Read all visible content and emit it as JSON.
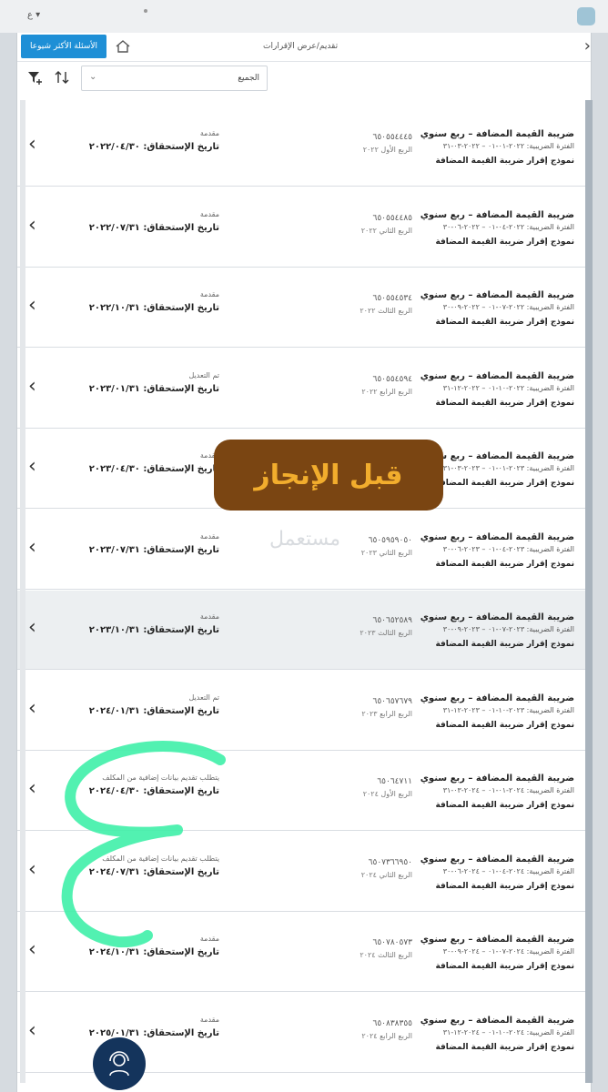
{
  "topbar": {
    "lang": "ع"
  },
  "header": {
    "faq_button": "الأسئلة الأكثر شيوعا",
    "breadcrumb": "تقديم/عرض الإقرارات"
  },
  "filter": {
    "selected": "الجميع"
  },
  "rows": [
    {
      "title": "ضريبة القيمة المضافة – ربع سنوي",
      "period": "الفترة الضريبية: ٢٠٢٢-٠١-٠١ – ٢٠٢٢-٠٣-٣١",
      "form": "نموذج إقرار ضريبة القيمة المضافة",
      "number": "٦٥٠٥٥٤٤٤٥",
      "quarter": "الربع الأول ٢٠٢٢",
      "status": "مقدمة",
      "due": "تاريخ الإستحقاق: ٢٠٢٢/٠٤/٣٠"
    },
    {
      "title": "ضريبة القيمة المضافة – ربع سنوي",
      "period": "الفترة الضريبية: ٢٠٢٢-٠٤-٠١ – ٢٠٢٢-٠٦-٣٠",
      "form": "نموذج إقرار ضريبة القيمة المضافة",
      "number": "٦٥٠٥٥٤٤٨٥",
      "quarter": "الربع الثاني ٢٠٢٢",
      "status": "مقدمة",
      "due": "تاريخ الإستحقاق: ٢٠٢٢/٠٧/٣١"
    },
    {
      "title": "ضريبة القيمة المضافة – ربع سنوي",
      "period": "الفترة الضريبية: ٢٠٢٢-٠٧-٠١ – ٢٠٢٢-٠٩-٣٠",
      "form": "نموذج إقرار ضريبة القيمة المضافة",
      "number": "٦٥٠٥٥٤٥٣٤",
      "quarter": "الربع الثالث ٢٠٢٢",
      "status": "مقدمة",
      "due": "تاريخ الإستحقاق: ٢٠٢٢/١٠/٣١"
    },
    {
      "title": "ضريبة القيمة المضافة – ربع سنوي",
      "period": "الفترة الضريبية: ٢٠٢٢-١٠-٠١ – ٢٠٢٢-١٢-٣١",
      "form": "نموذج إقرار ضريبة القيمة المضافة",
      "number": "٦٥٠٥٥٤٥٩٤",
      "quarter": "الربع الرابع ٢٠٢٢",
      "status": "تم التعديل",
      "due": "تاريخ الإستحقاق: ٢٠٢٣/٠١/٣١"
    },
    {
      "title": "ضريبة القيمة المضافة – ربع سنوي",
      "period": "الفترة الضريبية: ٢٠٢٣-٠١-٠١ – ٢٠٢٣-٠٣-٣١",
      "form": "نموذج إقرار ضريبة القيمة المضافة",
      "number": "",
      "quarter": "",
      "status": "مقدمة",
      "due": "تاريخ الإستحقاق: ٢٠٢٣/٠٤/٣٠"
    },
    {
      "title": "ضريبة القيمة المضافة – ربع سنوي",
      "period": "الفترة الضريبية: ٢٠٢٣-٠٤-٠١ – ٢٠٢٣-٠٦-٣٠",
      "form": "نموذج إقرار ضريبة القيمة المضافة",
      "number": "٦٥٠٥٩٥٩٠٥٠",
      "quarter": "الربع الثاني ٢٠٢٣",
      "status": "مقدمة",
      "due": "تاريخ الإستحقاق: ٢٠٢٣/٠٧/٣١"
    },
    {
      "title": "ضريبة القيمة المضافة – ربع سنوي",
      "period": "الفترة الضريبية: ٢٠٢٣-٠٧-٠١ – ٢٠٢٣-٠٩-٣٠",
      "form": "نموذج إقرار ضريبة القيمة المضافة",
      "number": "٦٥٠٦٥٢٥٨٩",
      "quarter": "الربع الثالث ٢٠٢٣",
      "status": "مقدمة",
      "due": "تاريخ الإستحقاق: ٢٠٢٣/١٠/٣١"
    },
    {
      "title": "ضريبة القيمة المضافة – ربع سنوي",
      "period": "الفترة الضريبية: ٢٠٢٣-١٠-٠١ – ٢٠٢٣-١٢-٣١",
      "form": "نموذج إقرار ضريبة القيمة المضافة",
      "number": "٦٥٠٦٥٧٦٧٩",
      "quarter": "الربع الرابع ٢٠٢٣",
      "status": "تم التعديل",
      "due": "تاريخ الإستحقاق: ٢٠٢٤/٠١/٣١"
    },
    {
      "title": "ضريبة القيمة المضافة – ربع سنوي",
      "period": "الفترة الضريبية: ٢٠٢٤-٠١-٠١ – ٢٠٢٤-٠٣-٣١",
      "form": "نموذج إقرار ضريبة القيمة المضافة",
      "number": "٦٥٠٦٤٧١١",
      "quarter": "الربع الأول ٢٠٢٤",
      "status": "يتطلب تقديم بيانات إضافية من المكلف",
      "due": "تاريخ الإستحقاق: ٢٠٢٤/٠٤/٣٠"
    },
    {
      "title": "ضريبة القيمة المضافة – ربع سنوي",
      "period": "الفترة الضريبية: ٢٠٢٤-٠٤-٠١ – ٢٠٢٤-٠٦-٣٠",
      "form": "نموذج إقرار ضريبة القيمة المضافة",
      "number": "٦٥٠٧٣٦٦٩٥٠",
      "quarter": "الربع الثاني ٢٠٢٤",
      "status": "يتطلب تقديم بيانات إضافية من المكلف",
      "due": "تاريخ الإستحقاق: ٢٠٢٤/٠٧/٣١"
    },
    {
      "title": "ضريبة القيمة المضافة – ربع سنوي",
      "period": "الفترة الضريبية: ٢٠٢٤-٠٧-٠١ – ٢٠٢٤-٠٩-٣٠",
      "form": "نموذج إقرار ضريبة القيمة المضافة",
      "number": "٦٥٠٧٨٠٥٧٣",
      "quarter": "الربع الثالث ٢٠٢٤",
      "status": "مقدمة",
      "due": "تاريخ الإستحقاق: ٢٠٢٤/١٠/٣١"
    },
    {
      "title": "ضريبة القيمة المضافة – ربع سنوي",
      "period": "الفترة الضريبية: ٢٠٢٤-١٠-٠١ – ٢٠٢٤-١٢-٣١",
      "form": "نموذج إقرار ضريبة القيمة المضافة",
      "number": "٦٥٠٨٣٨٣٥٥",
      "quarter": "الربع الرابع ٢٠٢٤",
      "status": "مقدمة",
      "due": "تاريخ الإستحقاق: ٢٠٢٥/٠١/٣١"
    }
  ],
  "overlay": {
    "label": "قبل الإنجاز"
  },
  "watermark": {
    "text": "مستعمل"
  },
  "colors": {
    "accent": "#1e8fd6",
    "overlay_bg": "#7a4512",
    "overlay_text": "#f2ad2d",
    "scribble": "#3ff0a8",
    "fab": "#14345c"
  }
}
